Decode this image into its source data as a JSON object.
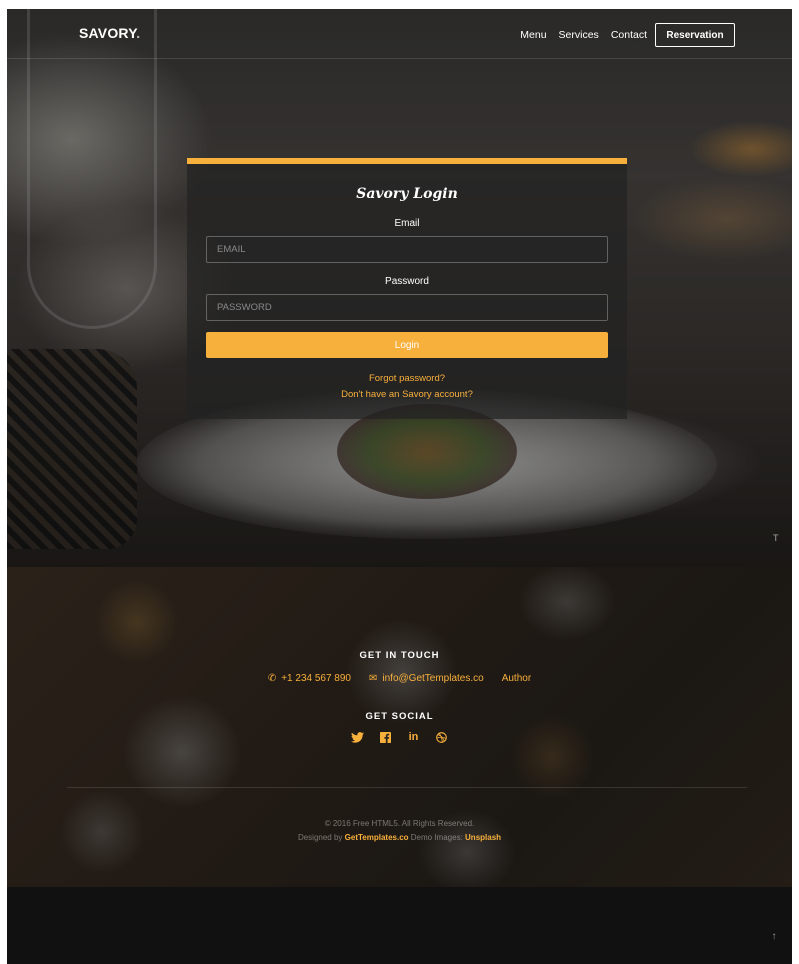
{
  "navbar": {
    "logo": "SAVORY",
    "logo_dot": ".",
    "links": [
      "Menu",
      "Services",
      "Contact"
    ],
    "reservation_label": "Reservation"
  },
  "login": {
    "title": "Savory Login",
    "email_label": "Email",
    "email_placeholder": "EMAIL",
    "email_value": "",
    "password_label": "Password",
    "password_placeholder": "PASSWORD",
    "password_value": "",
    "login_button": "Login",
    "forgot_password": "Forgot password?",
    "signup_link": "Don't have an Savory account?"
  },
  "hero": {
    "scroll_marker": "T"
  },
  "footer": {
    "get_in_touch": "GET IN TOUCH",
    "phone": "+1 234 567 890",
    "email": "info@GetTemplates.co",
    "author": "Author",
    "get_social": "GET SOCIAL",
    "social_icons": [
      "twitter-icon",
      "facebook-icon",
      "linkedin-icon",
      "dribbble-icon"
    ],
    "copyright_line1": "© 2016 Free HTML5. All Rights Reserved.",
    "designed_by_prefix": "Designed by",
    "designed_by_link": "GetTemplates.co",
    "demo_images_prefix": "Demo Images:",
    "demo_images_link": "Unsplash"
  },
  "back_to_top": "↑",
  "colors": {
    "accent": "#f8b03c",
    "card_bg": "#232323",
    "bottom_bar": "#111111"
  }
}
